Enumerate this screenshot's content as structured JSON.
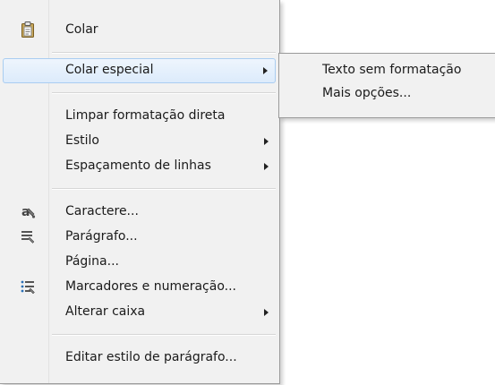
{
  "menu": {
    "items": [
      {
        "label": "Colar",
        "icon": "clipboard-icon"
      },
      {
        "label": "Colar especial",
        "submenu": true
      },
      {
        "label": "Limpar formatação direta"
      },
      {
        "label": "Estilo",
        "submenu": true
      },
      {
        "label": "Espaçamento de linhas",
        "submenu": true
      },
      {
        "label": "Caractere...",
        "icon": "character-icon"
      },
      {
        "label": "Parágrafo...",
        "icon": "paragraph-icon"
      },
      {
        "label": "Página..."
      },
      {
        "label": "Marcadores e numeração...",
        "icon": "bullets-numbering-icon"
      },
      {
        "label": "Alterar caixa",
        "submenu": true
      },
      {
        "label": "Editar estilo de parágrafo..."
      }
    ]
  },
  "submenu": {
    "items": [
      {
        "label": "Texto sem formatação"
      },
      {
        "label": "Mais opções..."
      }
    ]
  },
  "colors": {
    "highlight_border": "#a9cdf1",
    "highlight_bg": "#dcebfb",
    "menu_bg": "#f1f1f1"
  }
}
